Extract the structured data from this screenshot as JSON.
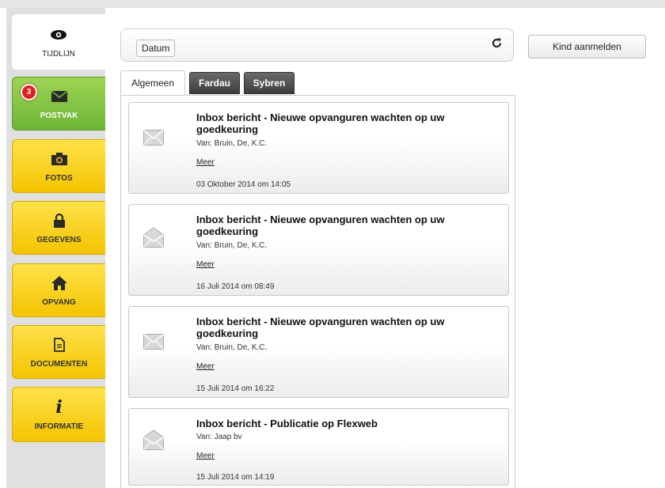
{
  "nav": {
    "timeline": {
      "label": "TIJDLIJN",
      "icon": "eye-icon"
    },
    "items": [
      {
        "label": "POSTVAK",
        "icon": "envelope-icon",
        "badge": "3",
        "color": "#7cc142"
      },
      {
        "label": "FOTOS",
        "icon": "camera-icon",
        "color": "#f8cf1c"
      },
      {
        "label": "GEGEVENS",
        "icon": "lock-icon",
        "color": "#f8cf1c"
      },
      {
        "label": "OPVANG",
        "icon": "home-icon",
        "color": "#f8cf1c"
      },
      {
        "label": "DOCUMENTEN",
        "icon": "document-icon",
        "color": "#f8cf1c"
      },
      {
        "label": "INFORMATIE",
        "icon": "info-icon",
        "color": "#f8cf1c"
      }
    ]
  },
  "toolbar": {
    "sort_label": "Datum",
    "refresh_icon": "refresh-icon"
  },
  "kind_button": "Kind aanmelden",
  "tabs": [
    {
      "label": "Algemeen",
      "active": true
    },
    {
      "label": "Fardau",
      "active": false
    },
    {
      "label": "Sybren",
      "active": false
    }
  ],
  "messages": [
    {
      "title": "Inbox bericht - Nieuwe opvanguren wachten op uw goedkeuring",
      "from": "Van: Bruin, De, K.C.",
      "more": "Meer",
      "date": "03 Oktober 2014 om 14:05",
      "icon": "envelope-closed-icon"
    },
    {
      "title": "Inbox bericht - Nieuwe opvanguren wachten op uw goedkeuring",
      "from": "Van: Bruin, De, K.C.",
      "more": "Meer",
      "date": "16 Juli 2014 om 08:49",
      "icon": "envelope-open-icon"
    },
    {
      "title": "Inbox bericht - Nieuwe opvanguren wachten op uw goedkeuring",
      "from": "Van: Bruin, De, K.C.",
      "more": "Meer",
      "date": "15 Juli 2014 om 16:22",
      "icon": "envelope-closed-icon"
    },
    {
      "title": "Inbox bericht - Publicatie op Flexweb",
      "from": "Van: Jaap bv",
      "more": "Meer",
      "date": "15 Juli 2014 om 14:19",
      "icon": "envelope-open-icon"
    }
  ]
}
